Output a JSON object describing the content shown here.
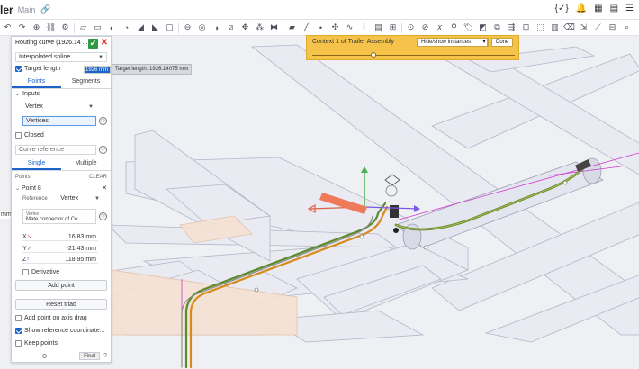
{
  "window": {
    "title": "ler",
    "branch": "Main"
  },
  "topbar_right": [
    "{✓}",
    "bell-icon",
    "grid-icon",
    "doc-icon",
    "menu-icon"
  ],
  "panel": {
    "title": "Routing curve (1926.14 ...",
    "spline_type": "Interpolated spline",
    "target_length_label": "Target length",
    "target_length_value": "1926 mm",
    "target_length_tip": "Target length: 1926.14075 mm",
    "tabs": [
      "Points",
      "Segments"
    ],
    "inputs_label": "Inputs",
    "input_type": "Vertex",
    "vertices_placeholder": "Vertices",
    "closed_label": "Closed",
    "curve_reference_placeholder": "Curve reference",
    "mode_tabs": [
      "Single",
      "Multiple"
    ],
    "points_label": "Points",
    "clear_label": "CLEAR",
    "point_name": "Point 8",
    "reference_label": "Reference",
    "reference_value": "Vertex",
    "vertex_label": "Vertex",
    "vertex_value": "Mate connector of Co...",
    "x_label": "X",
    "x_value": "16.83 mm",
    "y_label": "Y",
    "y_value": "-21.43 mm",
    "z_label": "Z",
    "z_value": "118.95 mm",
    "derivative_label": "Derivative",
    "add_point_label": "Add point",
    "reset_triad_label": "Reset triad",
    "add_point_axis_label": "Add point on axis drag",
    "show_ref_label": "Show reference coordinate...",
    "keep_points_label": "Keep points",
    "final_label": "Final"
  },
  "viewport": {
    "left_mm_label": "mm"
  },
  "context_banner": {
    "text": "Context 1 of Trailer Assembly",
    "hide_show_label": "Hide/show instances",
    "done_label": "Done",
    "slider_position": 0.3
  },
  "colors": {
    "accent": "#1e63c9",
    "ok": "#2f9a43",
    "banner": "#f6c34a",
    "cable_green": "#5a8a2a",
    "cable_orange": "#d98a1c"
  }
}
